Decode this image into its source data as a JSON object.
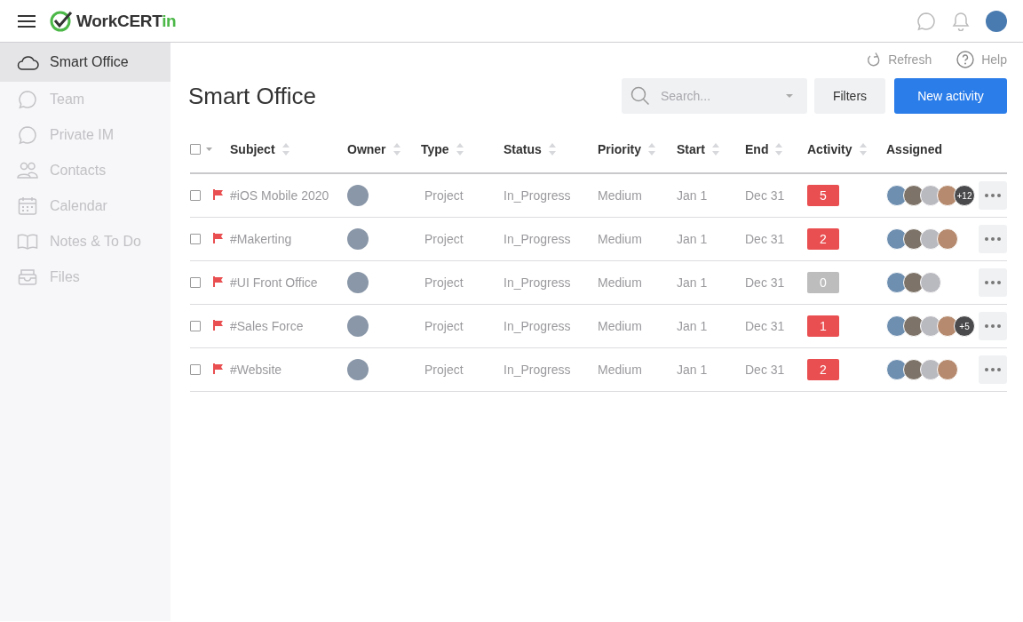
{
  "topbar": {
    "logo": {
      "name": "WorkCERT",
      "suffix": "in"
    }
  },
  "sidebar": {
    "items": [
      {
        "label": "Smart Office",
        "kind": "cloud",
        "selected": true
      },
      {
        "label": "Team",
        "kind": "chat",
        "selected": false
      },
      {
        "label": "Private IM",
        "kind": "chat",
        "selected": false
      },
      {
        "label": "Contacts",
        "kind": "people",
        "selected": false
      },
      {
        "label": "Calendar",
        "kind": "calendar",
        "selected": false
      },
      {
        "label": "Notes & To Do",
        "kind": "book",
        "selected": false
      },
      {
        "label": "Files",
        "kind": "tray",
        "selected": false
      }
    ]
  },
  "page": {
    "refresh": "Refresh",
    "help": "Help",
    "title": "Smart Office",
    "search": {
      "placeholder": "Search..."
    },
    "filters": "Filters",
    "new_activity": "New activity"
  },
  "table": {
    "header_checked": false,
    "columns": [
      {
        "label": "Subject",
        "sortable": true
      },
      {
        "label": "Owner",
        "sortable": true
      },
      {
        "label": "Type",
        "sortable": true
      },
      {
        "label": "Status",
        "sortable": true
      },
      {
        "label": "Priority",
        "sortable": true
      },
      {
        "label": "Start",
        "sortable": true
      },
      {
        "label": "End",
        "sortable": true
      },
      {
        "label": "Activity",
        "sortable": true
      },
      {
        "label": "Assigned",
        "sortable": false
      }
    ],
    "rows": [
      {
        "checked": false,
        "flagged": true,
        "subject": "#iOS Mobile 2020",
        "type": "Project",
        "status": "In_Progress",
        "priority": "Medium",
        "start": "Jan 1",
        "end": "Dec 31",
        "activity": {
          "count": "5",
          "color": "#e94e50"
        },
        "assignees": [
          {
            "kind": "photo"
          },
          {
            "kind": "photo"
          },
          {
            "kind": "photo"
          },
          {
            "kind": "photo"
          }
        ],
        "more": "+12"
      },
      {
        "checked": false,
        "flagged": true,
        "subject": "#Makerting",
        "type": "Project",
        "status": "In_Progress",
        "priority": "Medium",
        "start": "Jan 1",
        "end": "Dec 31",
        "activity": {
          "count": "2",
          "color": "#e94e50"
        },
        "assignees": [
          {
            "kind": "photo"
          },
          {
            "kind": "photo"
          },
          {
            "kind": "photo"
          },
          {
            "kind": "photo"
          }
        ]
      },
      {
        "checked": false,
        "flagged": true,
        "subject": "#UI Front Office",
        "type": "Project",
        "status": "In_Progress",
        "priority": "Medium",
        "start": "Jan 1",
        "end": "Dec 31",
        "activity": {
          "count": "0",
          "color": "#bdbdbd"
        },
        "assignees": [
          {
            "kind": "photo"
          },
          {
            "kind": "photo"
          },
          {
            "kind": "photo"
          }
        ]
      },
      {
        "checked": false,
        "flagged": true,
        "subject": "#Sales Force",
        "type": "Project",
        "status": "In_Progress",
        "priority": "Medium",
        "start": "Jan 1",
        "end": "Dec 31",
        "activity": {
          "count": "1",
          "color": "#e94e50"
        },
        "assignees": [
          {
            "kind": "photo"
          },
          {
            "kind": "photo"
          },
          {
            "kind": "photo"
          },
          {
            "kind": "photo"
          }
        ],
        "more": "+5"
      },
      {
        "checked": false,
        "flagged": true,
        "subject": "#Website",
        "type": "Project",
        "status": "In_Progress",
        "priority": "Medium",
        "start": "Jan 1",
        "end": "Dec 31",
        "activity": {
          "count": "2",
          "color": "#e94e50"
        },
        "assignees": [
          {
            "kind": "photo"
          },
          {
            "kind": "photo"
          },
          {
            "kind": "photo"
          },
          {
            "kind": "photo"
          }
        ]
      }
    ]
  }
}
